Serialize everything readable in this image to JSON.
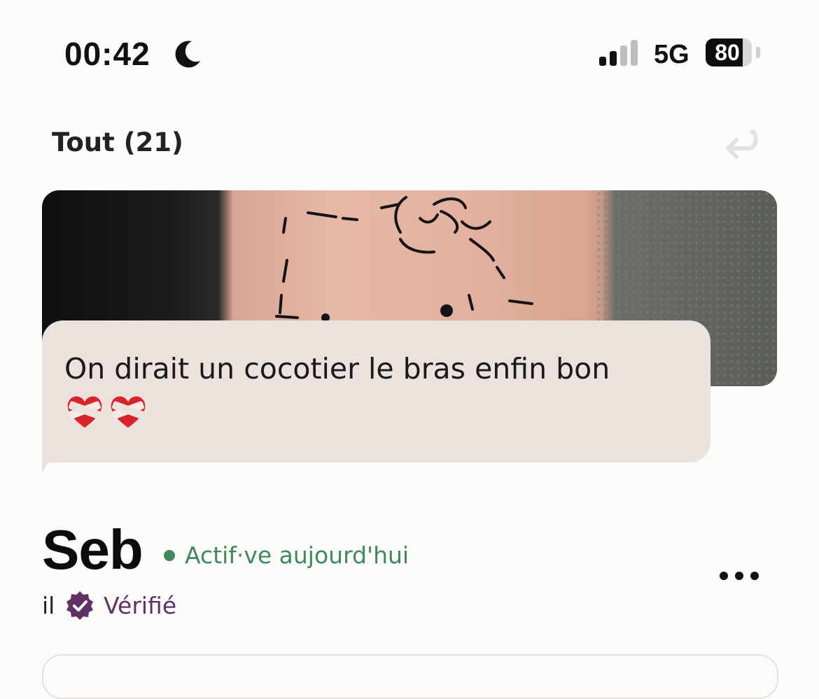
{
  "status_bar": {
    "time": "00:42",
    "network": "5G",
    "battery_percent": "80",
    "battery_level": 0.8,
    "icons": [
      "moon-icon",
      "signal-icon",
      "battery-icon"
    ]
  },
  "header": {
    "filter_label": "Tout (21)",
    "undo_icon": "undo-arrow-icon"
  },
  "message": {
    "text": "On dirait un cocotier le bras enfin bon",
    "emoji_icons": [
      "mending-heart-icon",
      "mending-heart-icon"
    ]
  },
  "profile": {
    "name": "Seb",
    "activity": "Actif·ve aujourd'hui",
    "pronoun": "il",
    "verified_label": "Vérifié",
    "more_icon": "more-dots-icon"
  },
  "colors": {
    "activity_green": "#3e8a5e",
    "verified_purple": "#5f3167",
    "bubble_bg": "#ebe1dd"
  }
}
